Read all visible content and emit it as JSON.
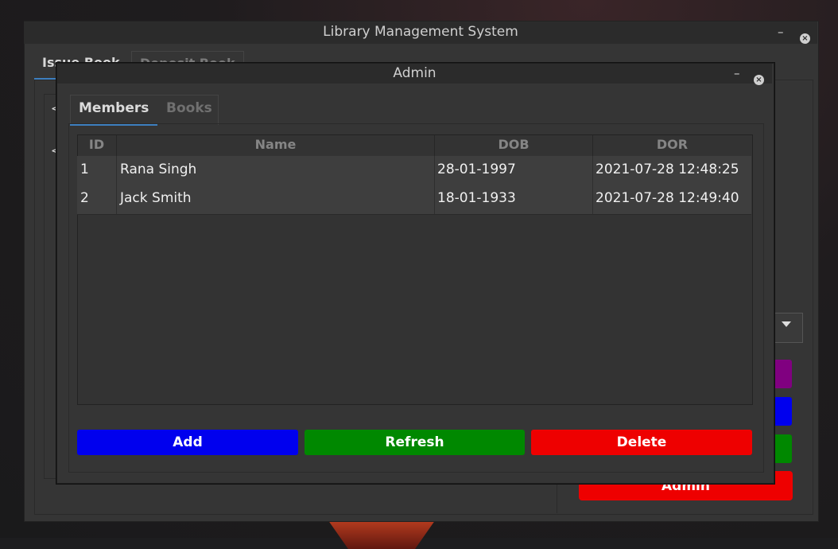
{
  "main_window": {
    "title": "Library Management System",
    "minimize": "–",
    "close": "×",
    "tabs": [
      "Issue Book",
      "Deposit Book"
    ],
    "left_arrows": [
      "<",
      "<"
    ],
    "admin_button": "Admin",
    "side_button_colors": [
      "#800080",
      "#0000ee",
      "#008800"
    ]
  },
  "admin_window": {
    "title": "Admin",
    "minimize": "–",
    "close": "×",
    "tabs": [
      {
        "label": "Members",
        "active": true
      },
      {
        "label": "Books",
        "active": false
      }
    ],
    "table": {
      "columns": [
        "ID",
        "Name",
        "DOB",
        "DOR"
      ],
      "rows": [
        [
          "1",
          "Rana Singh",
          "28-01-1997",
          "2021-07-28 12:48:25"
        ],
        [
          "2",
          "Jack Smith",
          "18-01-1933",
          "2021-07-28 12:49:40"
        ]
      ]
    },
    "buttons": {
      "add": {
        "label": "Add",
        "color": "#0000ee"
      },
      "refresh": {
        "label": "Refresh",
        "color": "#008800"
      },
      "delete": {
        "label": "Delete",
        "color": "#ee0000"
      }
    }
  }
}
